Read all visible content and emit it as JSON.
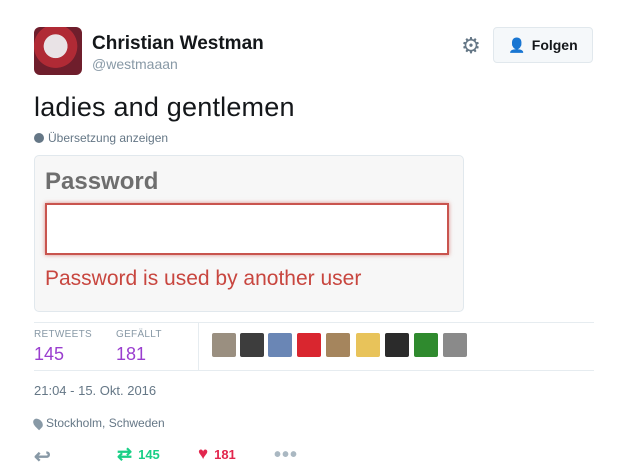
{
  "user": {
    "name": "Christian Westman",
    "handle": "@westmaaan"
  },
  "header": {
    "follow_label": "Folgen"
  },
  "tweet": {
    "text": "ladies and gentlemen",
    "translate_label": "Übersetzung anzeigen"
  },
  "media": {
    "field_label": "Password",
    "error_text": "Password is used by another user"
  },
  "stats": {
    "retweets_label": "RETWEETS",
    "retweets_value": "145",
    "likes_label": "GEFÄLLT",
    "likes_value": "181"
  },
  "likers": [
    {
      "color": "#9a8f80"
    },
    {
      "color": "#3d3d3d"
    },
    {
      "color": "#6a86b5"
    },
    {
      "color": "#d9262f"
    },
    {
      "color": "#a5855d"
    },
    {
      "color": "#e8c35a"
    },
    {
      "color": "#2b2b2b"
    },
    {
      "color": "#2f8a2e"
    },
    {
      "color": "#8a8a8a"
    }
  ],
  "meta": {
    "timestamp": "21:04 - 15. Okt. 2016",
    "location": "Stockholm, Schweden"
  },
  "actions": {
    "retweet_count": "145",
    "like_count": "181"
  },
  "colors": {
    "accent": "#1da1f2",
    "stat_value": "#9a3ecf",
    "retweet": "#19cf86",
    "like": "#e2264d",
    "error": "#c8463f"
  }
}
